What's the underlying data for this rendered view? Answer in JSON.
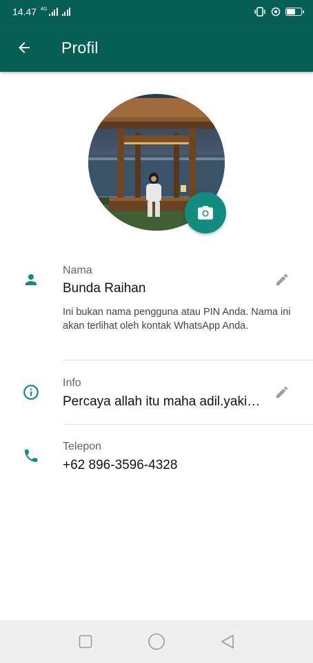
{
  "status_bar": {
    "time": "14.47",
    "network_type": "4G"
  },
  "app_bar": {
    "title": "Profil"
  },
  "profile": {
    "name": {
      "label": "Nama",
      "value": "Bunda Raihan",
      "hint": "Ini bukan nama pengguna atau PIN Anda. Nama ini akan terlihat oleh kontak WhatsApp Anda."
    },
    "about": {
      "label": "Info",
      "value": "Percaya allah itu maha adil.yaki…"
    },
    "phone": {
      "label": "Telepon",
      "value": "+62 896-3596-4328"
    }
  },
  "colors": {
    "header": "#075e54",
    "accent": "#128c7e",
    "icon": "#128c7e",
    "edit_icon": "#9e9e9e"
  },
  "icons": {
    "back": "arrow-left-icon",
    "camera": "camera-icon",
    "name": "person-icon",
    "about": "info-circle-icon",
    "phone": "phone-icon",
    "edit": "pencil-icon",
    "nav": [
      "square-icon",
      "circle-icon",
      "triangle-back-icon"
    ]
  }
}
